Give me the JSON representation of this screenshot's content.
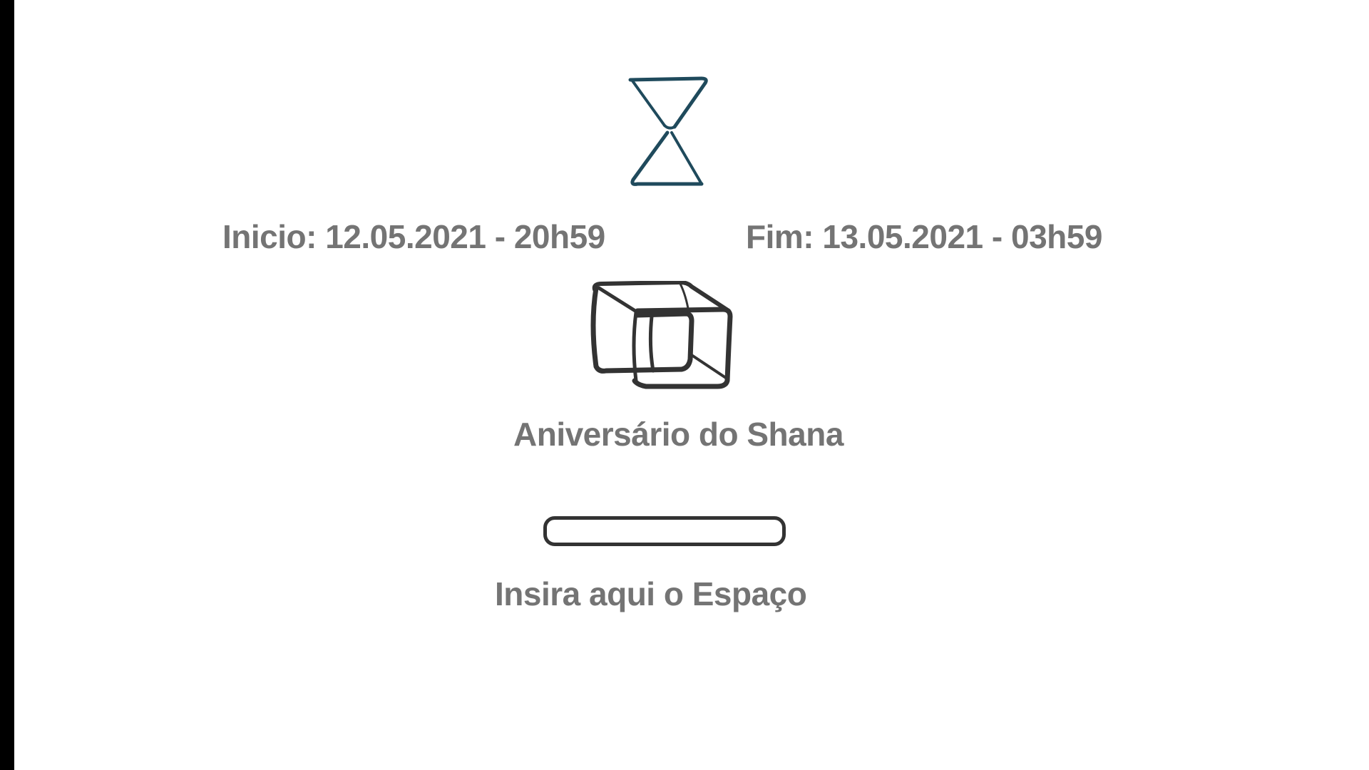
{
  "schedule": {
    "start_text": "Inicio: 12.05.2021 - 20h59",
    "end_text": "Fim: 13.05.2021 - 03h59"
  },
  "event": {
    "name": "Aniversário do Shana"
  },
  "space": {
    "input_value": "",
    "label": "Insira aqui o Espaço"
  },
  "icons": {
    "hourglass": "hourglass-icon",
    "box": "box-icon"
  },
  "colors": {
    "text": "#747474",
    "hourglass": "#1f4a5c",
    "box": "#333333",
    "border": "#000000"
  }
}
